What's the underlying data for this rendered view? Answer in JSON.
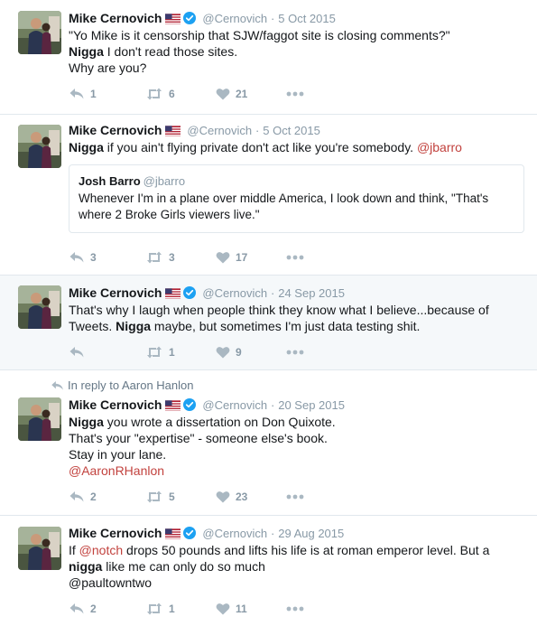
{
  "colors": {
    "link": "#c2423e",
    "muted": "#8899a6",
    "verified": "#1da1f2",
    "highlight_bg": "#f5f8fa"
  },
  "tweets": [
    {
      "fullname": "Mike Cernovich",
      "username": "@Cernovich",
      "sep": "·",
      "time": "5 Oct 2015",
      "lines": [
        "\"Yo Mike is it censorship that SJW/faggot site is closing comments?\"",
        "Nigga",
        " I don't read those sites.",
        "Why are you?"
      ],
      "counts": {
        "reply": "1",
        "retweet": "6",
        "like": "21"
      }
    },
    {
      "fullname": "Mike Cernovich",
      "username": "@Cernovich",
      "sep": "·",
      "time": "5 Oct 2015",
      "bold": "Nigga",
      "text": " if you ain't flying private don't act like you're somebody. ",
      "mention": "@jbarro",
      "quote": {
        "name": "Josh Barro",
        "handle": "@jbarro",
        "line1": "Whenever I'm in a plane over middle America, I look down and think, \"That's",
        "line2": "where 2 Broke Girls viewers live.\""
      },
      "counts": {
        "reply": "3",
        "retweet": "3",
        "like": "17"
      }
    },
    {
      "fullname": "Mike Cernovich",
      "username": "@Cernovich",
      "sep": "·",
      "time": "24 Sep 2015",
      "line1": "That's why I laugh when people think they know what I believe...because of",
      "line2a": "Tweets. ",
      "bold": "Nigga",
      "line2b": " maybe, but sometimes I'm just data testing shit.",
      "counts": {
        "reply": "",
        "retweet": "1",
        "like": "9"
      }
    },
    {
      "reply_context": "In reply to Aaron Hanlon",
      "fullname": "Mike Cernovich",
      "username": "@Cernovich",
      "sep": "·",
      "time": "20 Sep 2015",
      "bold": "Nigga",
      "line1": " you wrote a dissertation on Don Quixote.",
      "line2": "That's your \"expertise\" - someone else's book.",
      "line3": "Stay in your lane.",
      "mention": "@AaronRHanlon",
      "counts": {
        "reply": "2",
        "retweet": "5",
        "like": "23"
      }
    },
    {
      "fullname": "Mike Cernovich",
      "username": "@Cernovich",
      "sep": "·",
      "time": "29 Aug 2015",
      "pre": "If ",
      "mention": "@notch",
      "line1": " drops 50 pounds and lifts his life is at roman emperor level. But a",
      "bold": "nigga",
      "line2": " like me can only do so much",
      "line3": "@paultowntwo",
      "counts": {
        "reply": "2",
        "retweet": "1",
        "like": "11"
      }
    }
  ]
}
